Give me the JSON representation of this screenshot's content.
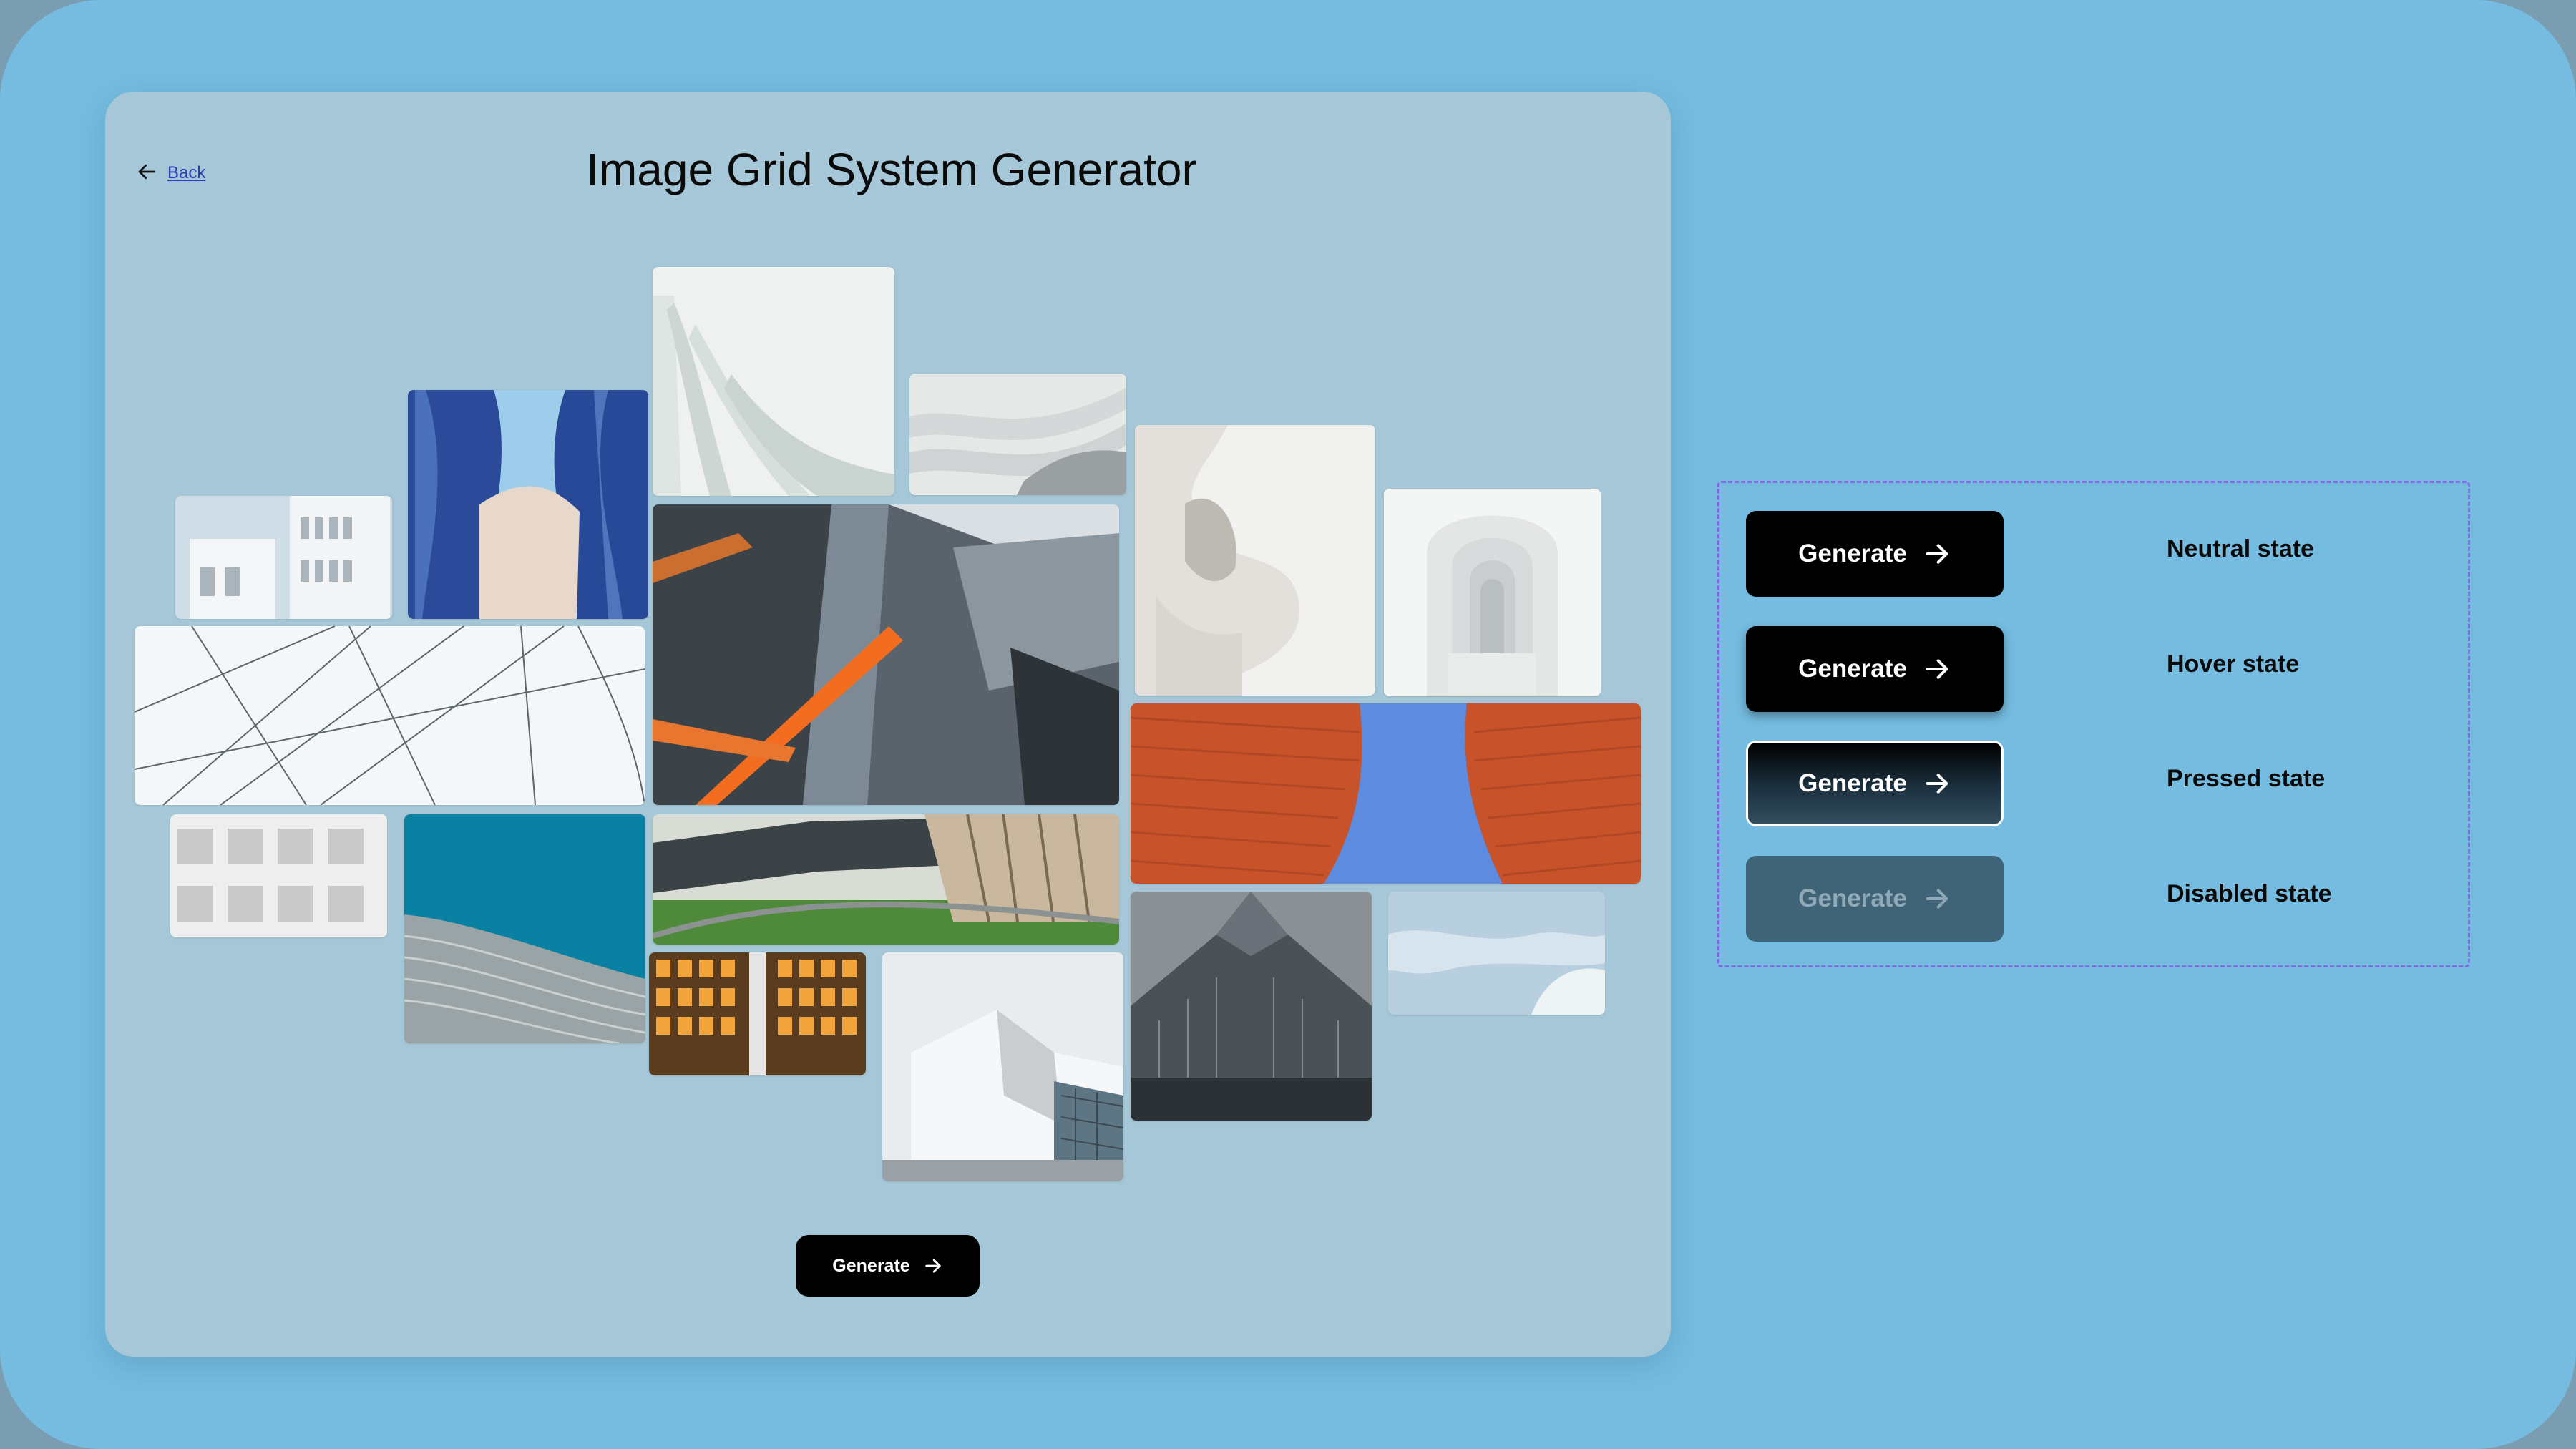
{
  "header": {
    "back_label": "Back",
    "title": "Image Grid System Generator"
  },
  "main": {
    "generate_label": "Generate"
  },
  "states": [
    {
      "button_label": "Generate",
      "label": "Neutral state"
    },
    {
      "button_label": "Generate",
      "label": "Hover state"
    },
    {
      "button_label": "Generate",
      "label": "Pressed state"
    },
    {
      "button_label": "Generate",
      "label": "Disabled state"
    }
  ],
  "colors": {
    "background": "#75bce0",
    "card": "#a5c7d7",
    "button": "#000000",
    "disabled_button": "#3f6478",
    "states_border": "#8a63e6",
    "back_link": "#2b3fb5"
  },
  "icons": {
    "back": "arrow-left-icon",
    "button": "arrow-right-icon"
  }
}
